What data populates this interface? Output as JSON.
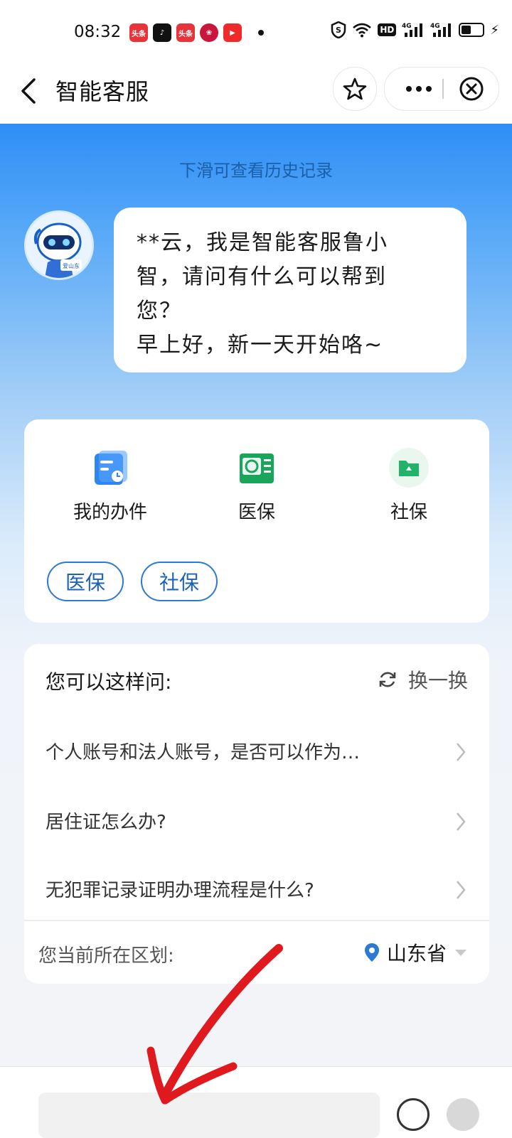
{
  "status_bar": {
    "time": "08:32",
    "app_icons": [
      {
        "name": "toutiao-news-icon",
        "text": "头条",
        "color": "#e8333a"
      },
      {
        "name": "tiktok-icon",
        "text": "♪",
        "color": "#111111"
      },
      {
        "name": "toutiao-icon",
        "text": "头条",
        "color": "#e8333a"
      },
      {
        "name": "app-red-icon",
        "text": "❀",
        "color": "#c9163a"
      },
      {
        "name": "video-play-icon",
        "text": "▶",
        "color": "#ee2a2a"
      }
    ],
    "right_icons": [
      "shield-icon",
      "wifi-icon",
      "hd-icon",
      "signal-4g-icon",
      "signal-4g-icon",
      "battery-icon",
      "charging-icon"
    ],
    "hd_text": "HD",
    "net_label": "4G"
  },
  "header": {
    "title": "智能客服"
  },
  "chat": {
    "history_hint": "下滑可查看历史记录",
    "avatar_text": "爱山东",
    "greeting_lines": [
      "**云，我是智能客服鲁小",
      "智，请问有什么可以帮到",
      "您？",
      "早上好，新一天开始咯~"
    ]
  },
  "services": [
    {
      "label": "我的办件",
      "icon": "document-list-icon",
      "color": "#2f86f0"
    },
    {
      "label": "医保",
      "icon": "medical-insurance-card-icon",
      "color": "#19a55a"
    },
    {
      "label": "社保",
      "icon": "folder-icon",
      "color": "#21b36a"
    }
  ],
  "chips": [
    "医保",
    "社保"
  ],
  "suggestions": {
    "title": "您可以这样问:",
    "refresh_label": "换一换",
    "questions": [
      "个人账号和法人账号，是否可以作为…",
      "居住证怎么办?",
      "无犯罪记录证明办理流程是什么?"
    ],
    "region_label": "您当前所在区划:",
    "region_value": "山东省"
  },
  "input_bar": {
    "placeholder": ""
  },
  "colors": {
    "primary_blue": "#2e8ef6",
    "chip_border": "#2b7ad6",
    "annotation_arrow": "#e0191e"
  }
}
